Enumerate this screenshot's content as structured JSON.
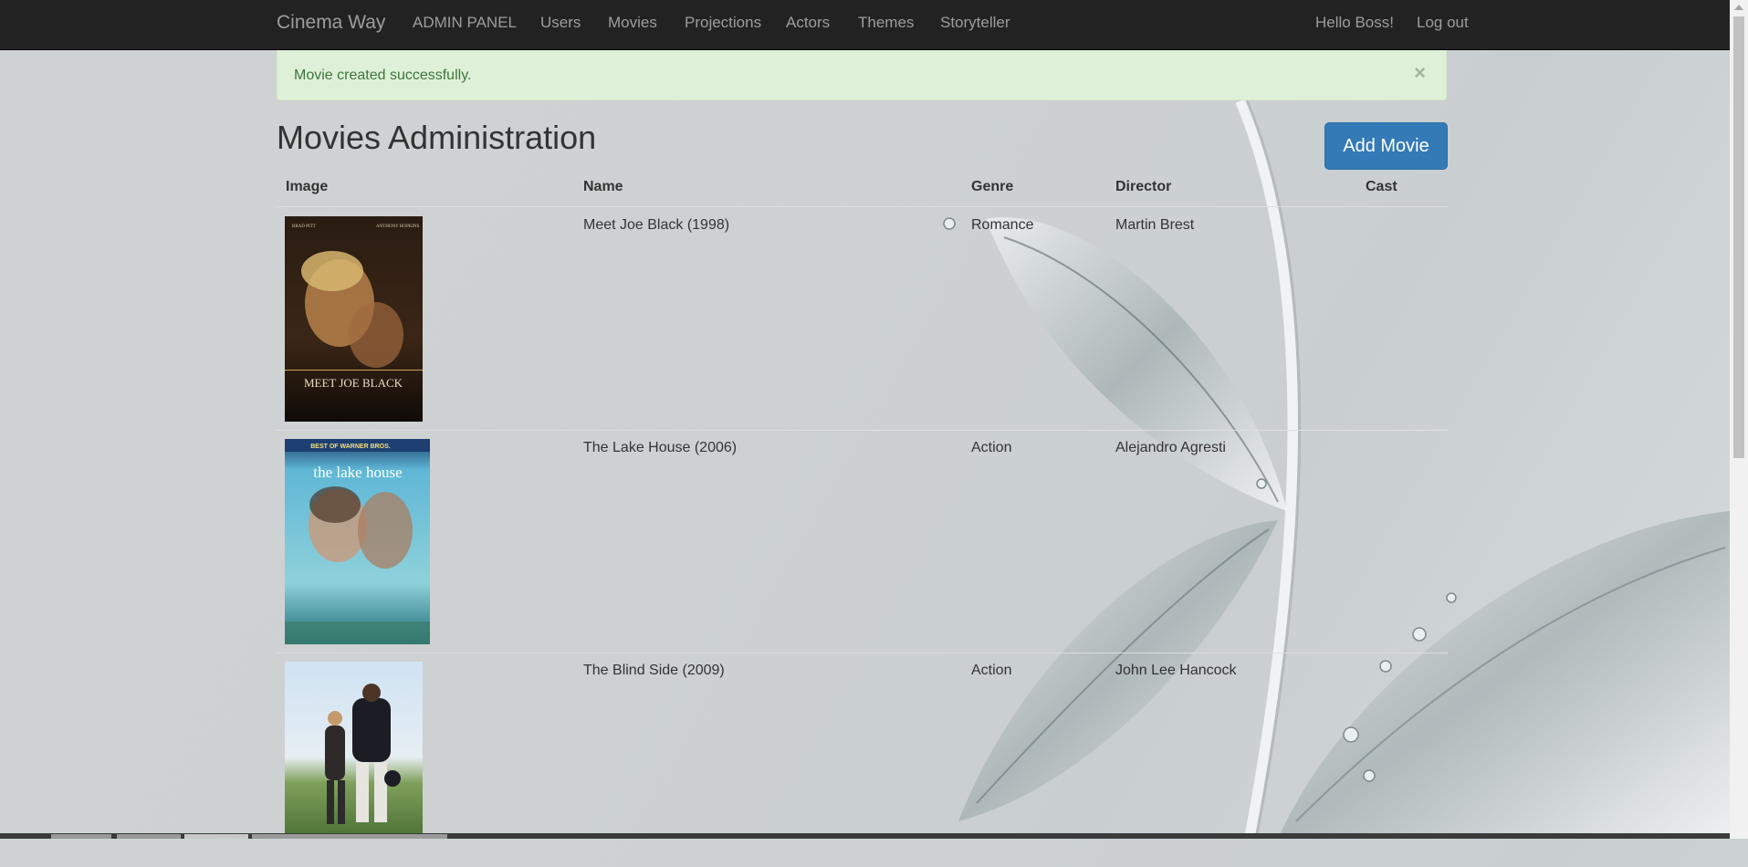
{
  "navbar": {
    "brand": "Cinema Way",
    "items": [
      "ADMIN PANEL",
      "Users",
      "Movies",
      "Projections",
      "Actors",
      "Themes",
      "Storyteller"
    ],
    "greeting": "Hello Boss!",
    "logout": "Log out"
  },
  "alert": {
    "message": "Movie created successfully.",
    "close": "×"
  },
  "page": {
    "title": "Movies Administration",
    "add_button": "Add Movie"
  },
  "table": {
    "headers": [
      "Image",
      "Name",
      "Genre",
      "Director",
      "Cast"
    ],
    "rows": [
      {
        "name": "Meet Joe Black (1998)",
        "genre": "Romance",
        "director": "Martin Brest",
        "cast": "",
        "poster": {
          "top_left": "BRAD PITT",
          "top_right": "ANTHONY HOPKINS",
          "title": "MEET JOE BLACK"
        }
      },
      {
        "name": "The Lake House (2006)",
        "genre": "Action",
        "director": "Alejandro Agresti",
        "cast": "",
        "poster": {
          "banner": "BEST OF WARNER BROS.",
          "title": "the lake house"
        }
      },
      {
        "name": "The Blind Side (2009)",
        "genre": "Action",
        "director": "John Lee Hancock",
        "cast": "",
        "poster": {
          "title": ""
        }
      }
    ]
  },
  "colors": {
    "navbar": "#222222",
    "alert_bg": "#dff0d8",
    "alert_text": "#3c763d",
    "primary": "#337ab7"
  }
}
